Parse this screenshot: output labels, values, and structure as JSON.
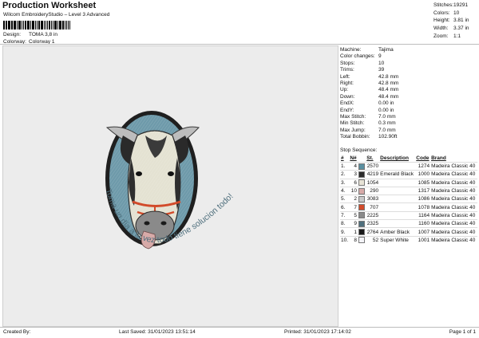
{
  "header": {
    "title": "Production Worksheet",
    "subtitle": "Wilcom EmbroideryStudio – Level 3 Advanced",
    "design_label": "Design:",
    "design_value": "TOMA 3,8 in",
    "colorway_label": "Colorway:",
    "colorway_value": "Colorway 1"
  },
  "summary": [
    {
      "label": "Stitches:",
      "value": "19291"
    },
    {
      "label": "Colors:",
      "value": "10"
    },
    {
      "label": "Height:",
      "value": "3.81 in"
    },
    {
      "label": "Width:",
      "value": "3.37 in"
    },
    {
      "label": "Zoom:",
      "value": "1:1"
    }
  ],
  "params": [
    {
      "label": "Machine:",
      "value": "Tajima"
    },
    {
      "label": "Color changes:",
      "value": "9"
    },
    {
      "label": "Stops:",
      "value": "10"
    },
    {
      "label": "Trims:",
      "value": "39"
    },
    {
      "label": "Left:",
      "value": "42.8 mm"
    },
    {
      "label": "Right:",
      "value": "42.8 mm"
    },
    {
      "label": "Up:",
      "value": "48.4 mm"
    },
    {
      "label": "Down:",
      "value": "48.4 mm"
    },
    {
      "label": "EndX:",
      "value": "0.00 in"
    },
    {
      "label": "EndY:",
      "value": "0.00 in"
    },
    {
      "label": "Max Stitch:",
      "value": "7.0 mm"
    },
    {
      "label": "Min Stitch:",
      "value": "0.3 mm"
    },
    {
      "label": "Max Jump:",
      "value": "7.0 mm"
    },
    {
      "label": "Total Bobbin:",
      "value": "102.90ft"
    }
  ],
  "stop_sequence": {
    "label": "Stop Sequence:",
    "columns": [
      "#",
      "N#",
      "St.",
      "Description",
      "Code",
      "Brand"
    ],
    "rows": [
      {
        "n": "1.",
        "needle": "4",
        "color": "#5a8fa0",
        "st": "2570",
        "desc": "",
        "code": "1274",
        "brand": "Madeira Classic 40"
      },
      {
        "n": "2.",
        "needle": "3",
        "color": "#2b2b2b",
        "st": "4219",
        "desc": "Emerald Black",
        "code": "1000",
        "brand": "Madeira Classic 40"
      },
      {
        "n": "3.",
        "needle": "6",
        "color": "#e7e3d6",
        "st": "1054",
        "desc": "",
        "code": "1085",
        "brand": "Madeira Classic 40"
      },
      {
        "n": "4.",
        "needle": "10",
        "color": "#d7aaa8",
        "st": "290",
        "desc": "",
        "code": "1317",
        "brand": "Madeira Classic 40"
      },
      {
        "n": "5.",
        "needle": "2",
        "color": "#c8c8c8",
        "st": "3083",
        "desc": "",
        "code": "1086",
        "brand": "Madeira Classic 40"
      },
      {
        "n": "6.",
        "needle": "7",
        "color": "#d24b2a",
        "st": "707",
        "desc": "",
        "code": "1078",
        "brand": "Madeira Classic 40"
      },
      {
        "n": "7.",
        "needle": "5",
        "color": "#8a8a8a",
        "st": "2225",
        "desc": "",
        "code": "1164",
        "brand": "Madeira Classic 40"
      },
      {
        "n": "8.",
        "needle": "9",
        "color": "#4f6f7d",
        "st": "2325",
        "desc": "",
        "code": "1160",
        "brand": "Madeira Classic 40"
      },
      {
        "n": "9.",
        "needle": "1",
        "color": "#1a1a1a",
        "st": "2764",
        "desc": "Amber Black",
        "code": "1007",
        "brand": "Madeira Classic 40"
      },
      {
        "n": "10.",
        "needle": "8",
        "color": "#f4f4f8",
        "st": "52",
        "desc": "Super White",
        "code": "1001",
        "brand": "Madeira Classic 40"
      }
    ]
  },
  "design_text": "Toma un día a la vez todo tiene solucion todo!",
  "footer": {
    "created_by": "Created By:",
    "last_saved": "Last Saved: 31/01/2023 13:51:14",
    "printed": "Printed: 31/01/2023 17:14:02",
    "page": "Page 1 of 1"
  }
}
